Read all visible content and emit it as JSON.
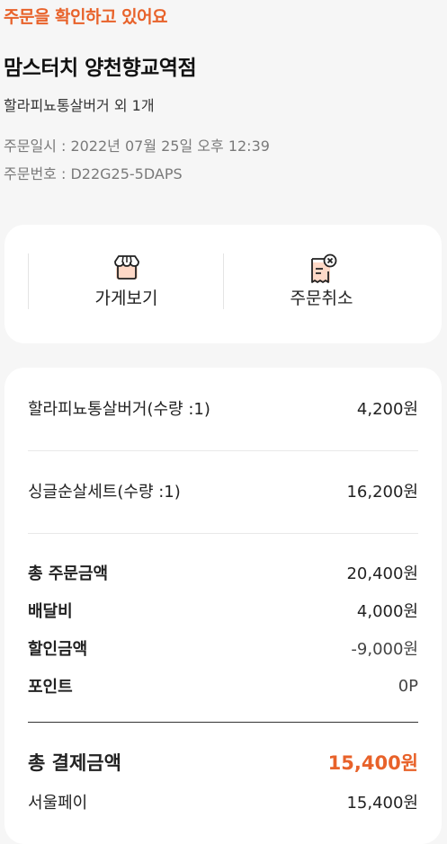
{
  "order": {
    "status": "주문을 확인하고 있어요",
    "store_name": "맘스터치 양천향교역점",
    "menu_summary": "할라피뇨통살버거 외 1개",
    "order_date": "주문일시 : 2022년 07월 25일 오후 12:39",
    "order_number": "주문번호 : D22G25-5DAPS"
  },
  "actions": {
    "store_label": "가게보기",
    "cancel_label": "주문취소",
    "store_icon": "store-icon",
    "cancel_icon": "receipt-cancel-icon"
  },
  "items": [
    {
      "name": "할라피뇨통살버거(수량 :1)",
      "price": "4,200원"
    },
    {
      "name": "싱글순살세트(수량 :1)",
      "price": "16,200원"
    }
  ],
  "summary": {
    "subtotal_label": "총 주문금액",
    "subtotal": "20,400원",
    "delivery_label": "배달비",
    "delivery": "4,000원",
    "discount_label": "할인금액",
    "discount": "-9,000원",
    "point_label": "포인트",
    "point": "0P"
  },
  "payment": {
    "total_label": "총 결제금액",
    "total": "15,400원",
    "method_label": "서울페이",
    "method_amount": "15,400원"
  },
  "colors": {
    "accent": "#e8622a",
    "background": "#f6f6f6"
  }
}
